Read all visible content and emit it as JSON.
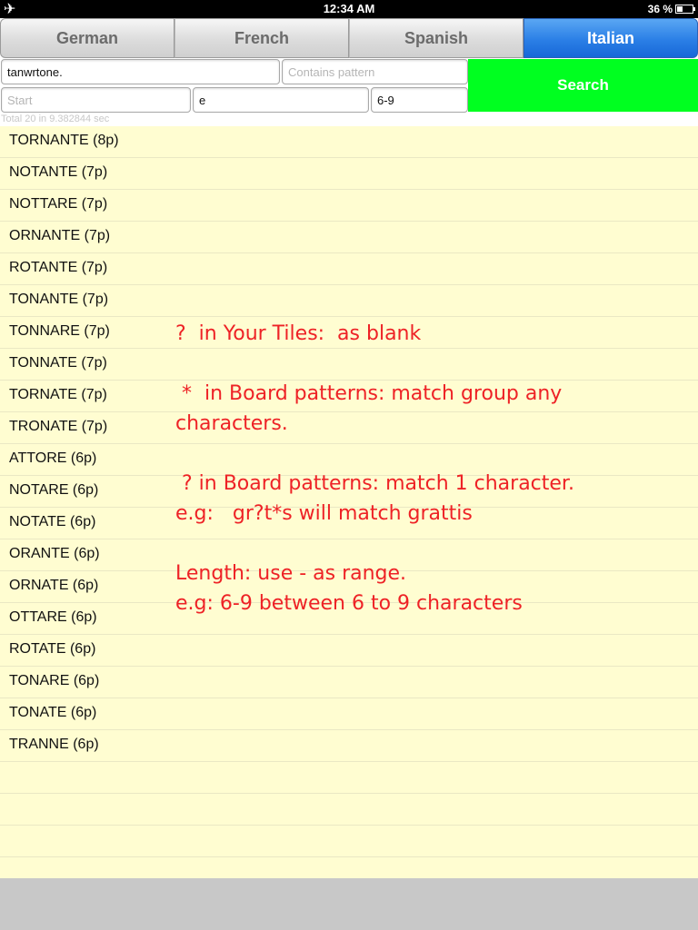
{
  "status_bar": {
    "airplane_icon": "airplane-icon",
    "time": "12:34 AM",
    "battery_percent": "36 %",
    "battery_level": 0.36
  },
  "tabs": [
    {
      "label": "German",
      "selected": false
    },
    {
      "label": "French",
      "selected": false
    },
    {
      "label": "Spanish",
      "selected": false
    },
    {
      "label": "Italian",
      "selected": true
    }
  ],
  "search": {
    "tiles_value": "tanwrtone.",
    "pattern_placeholder": "Contains pattern",
    "pattern_value": "",
    "start_placeholder": "Start",
    "start_value": "",
    "end_value": "e",
    "length_value": "6-9",
    "button_label": "Search",
    "button_color": "#00ff20",
    "total_text": "Total 20 in 9.382844 sec"
  },
  "results": [
    "TORNANTE (8p)",
    "NOTANTE (7p)",
    "NOTTARE (7p)",
    "ORNANTE (7p)",
    "ROTANTE (7p)",
    "TONANTE (7p)",
    "TONNARE (7p)",
    "TONNATE (7p)",
    "TORNATE (7p)",
    "TRONATE (7p)",
    "ATTORE (6p)",
    "NOTARE (6p)",
    "NOTATE (6p)",
    "ORANTE (6p)",
    "ORNATE (6p)",
    "OTTARE (6p)",
    "ROTATE (6p)",
    "TONARE (6p)",
    "TONATE (6p)",
    "TRANNE (6p)"
  ],
  "help": {
    "line1": "?  in Your Tiles:  as blank",
    "line2": " *  in Board patterns: match group any",
    "line3": "characters.",
    "line4": " ? in Board patterns: match 1 character.",
    "line5": "e.g:   gr?t*s will match grattis",
    "line6": "Length: use - as range.",
    "line7": "e.g: 6-9 between 6 to 9 characters",
    "color": "#ee2226"
  },
  "colors": {
    "selected_tab": "#2b7fe6",
    "list_background": "#fffdd1"
  }
}
